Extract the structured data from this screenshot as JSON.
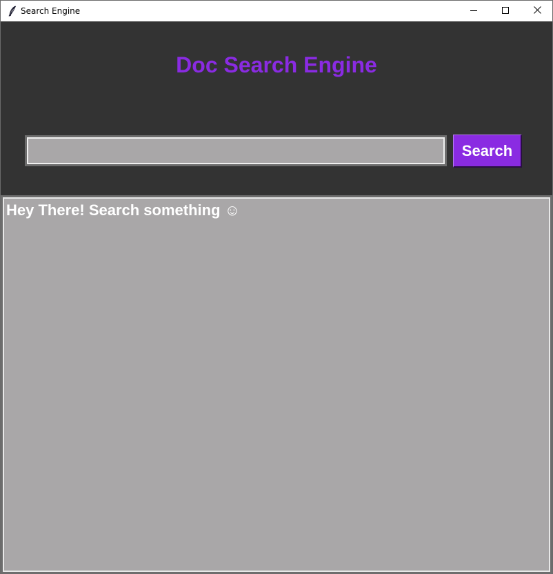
{
  "window": {
    "title": "Search Engine"
  },
  "header": {
    "title": "Doc Search Engine"
  },
  "search": {
    "value": "",
    "placeholder": "",
    "button_label": "Search"
  },
  "results": {
    "message": "Hey There! Search something ☺"
  },
  "colors": {
    "accent": "#8a2be2",
    "background": "#333333",
    "panel": "#a9a7a8",
    "text_light": "#ffffff"
  },
  "icons": {
    "app": "feather-icon",
    "minimize": "minimize-icon",
    "maximize": "maximize-icon",
    "close": "close-icon"
  }
}
